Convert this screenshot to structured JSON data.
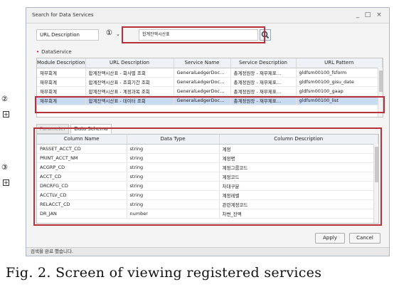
{
  "window": {
    "title": "Search for Data Services",
    "controls": [
      "_",
      "□",
      "×"
    ]
  },
  "search": {
    "type_selected": "URL Description",
    "marker": "①",
    "query": "합계잔액시산표",
    "icon": "search-icon"
  },
  "service_section": {
    "label": "DataService"
  },
  "services_table": {
    "columns": [
      "Module Description",
      "URL Description",
      "Service Name",
      "Service Description",
      "URL Pattern"
    ],
    "rows": [
      [
        "재무회계",
        "합계잔액시산표 - 회사별 조회",
        "GeneralLedgerDoc…",
        "총계정원장 - 재무제표…",
        "gldfsm00100_fsform"
      ],
      [
        "재무회계",
        "합계잔액시산표 - 조회기간 조회",
        "GeneralLedgerDoc…",
        "총계정원장 - 재무제표…",
        "gldfsm00100_gisu_date"
      ],
      [
        "재무회계",
        "합계잔액시산표 - 계정과목 조회",
        "GeneralLedgerDoc…",
        "총계정원장 - 재무제표…",
        "gldfsm00100_gaap"
      ],
      [
        "재무회계",
        "합계잔액시산표 - 데이터 조회",
        "GeneralLedgerDoc…",
        "총계정원장 - 재무제표…",
        "gldfsm00100_list"
      ]
    ],
    "selected_row": 3
  },
  "tabs": [
    "Parameter",
    "Data Schema"
  ],
  "active_tab": "Data Schema",
  "schema_table": {
    "columns": [
      "Column Name",
      "Data Type",
      "Column Description"
    ],
    "rows": [
      [
        "PASSET_ACCT_CD",
        "string",
        "계정"
      ],
      [
        "PRINT_ACCT_NM",
        "string",
        "계정명"
      ],
      [
        "ACGRP_CD",
        "string",
        "계정그룹코드"
      ],
      [
        "ACCT_CD",
        "string",
        "계정코드"
      ],
      [
        "DRCRFG_CD",
        "string",
        "차대구분"
      ],
      [
        "ACCTLV_CD",
        "string",
        "계정레벨"
      ],
      [
        "RELACCT_CD",
        "string",
        "관련계정코드"
      ],
      [
        "DR_JAN",
        "number",
        "차변_잔액"
      ]
    ]
  },
  "buttons": {
    "apply": "Apply",
    "cancel": "Cancel"
  },
  "status": "검색을 완료 했습니다.",
  "annotations": {
    "marker_2": "②",
    "marker_3": "③",
    "expand": "⊞"
  },
  "caption": "Fig. 2. Screen of viewing registered services",
  "colors": {
    "highlight_box": "#b8313a",
    "selected_row": "#c9dbf1"
  }
}
